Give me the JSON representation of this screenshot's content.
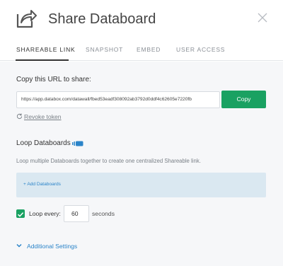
{
  "dialog": {
    "title": "Share Databoard",
    "icons": {
      "share": "share-arrow-icon",
      "close": "close-icon"
    }
  },
  "tabs": [
    {
      "label": "SHAREABLE LINK",
      "active": true
    },
    {
      "label": "SNAPSHOT",
      "active": false
    },
    {
      "label": "EMBED",
      "active": false
    },
    {
      "label": "USER ACCESS",
      "active": false
    }
  ],
  "share": {
    "url_label": "Copy this URL to share:",
    "url_value": "https://app.databox.com/datawall/fbed53eadf308092ab3792d0ddf4c62605e7220fb",
    "copy_label": "Copy",
    "revoke_label": "Revoke token"
  },
  "loop": {
    "title": "Loop Databoards",
    "description": "Loop multiple Databoards together to create one centralized Shareable link.",
    "add_label": "+ Add Databoards",
    "every_label": "Loop every:",
    "every_checked": true,
    "seconds_value": "60",
    "seconds_label": "seconds"
  },
  "additional": {
    "label": "Additional Settings"
  },
  "colors": {
    "accent_green": "#1aa162",
    "link_blue": "#2b84c9",
    "add_box_bg": "#dae8f1",
    "content_bg": "#f6f7f9"
  }
}
